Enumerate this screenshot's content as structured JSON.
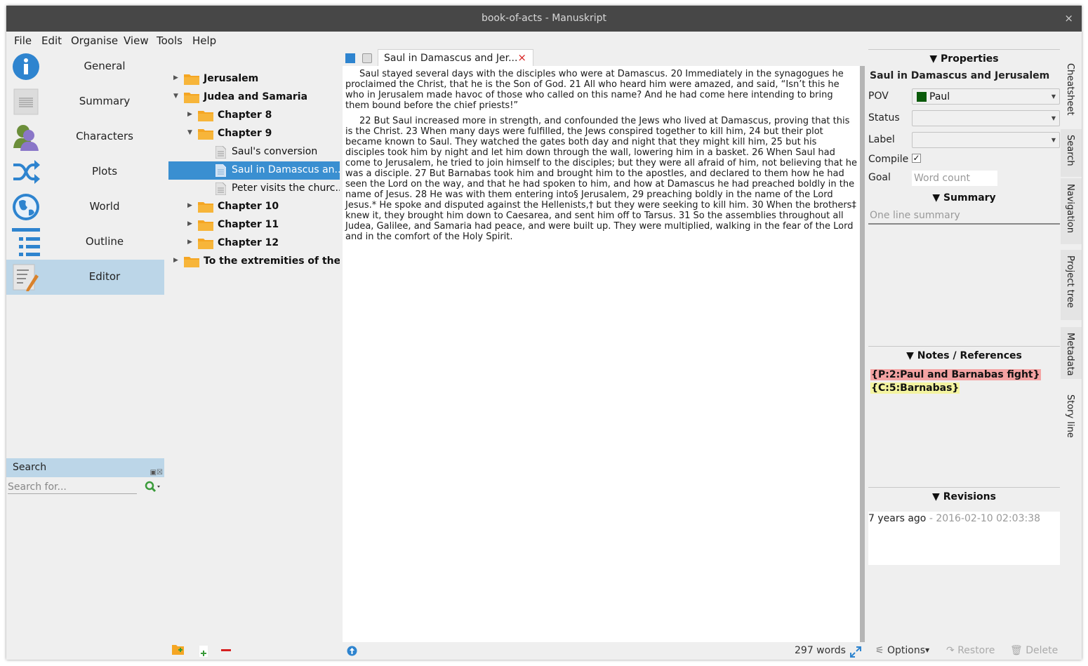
{
  "window": {
    "title": "book-of-acts - Manuskript",
    "close_glyph": "×"
  },
  "menu": {
    "file": "File",
    "edit": "Edit",
    "organise": "Organise",
    "view": "View",
    "tools": "Tools",
    "help": "Help"
  },
  "nav": {
    "general": "General",
    "summary": "Summary",
    "characters": "Characters",
    "plots": "Plots",
    "world": "World",
    "outline": "Outline",
    "editor": "Editor"
  },
  "search": {
    "title": "Search",
    "placeholder": "Search for..."
  },
  "tree": {
    "jerusalem": "Jerusalem",
    "judea": "Judea and Samaria",
    "ch8": "Chapter 8",
    "ch9": "Chapter 9",
    "sauls_conversion": "Saul's conversion",
    "saul_damascus": "Saul in Damascus an...",
    "peter_visits": "Peter visits the churc...",
    "ch10": "Chapter 10",
    "ch11": "Chapter 11",
    "ch12": "Chapter 12",
    "extremities": "To the extremities of the ..."
  },
  "editor": {
    "tab_title": "Saul in Damascus and Jer...",
    "tab_close": "×",
    "paragraph1": "Saul stayed several days with the disciples who were at Damascus. 20 Immediately in the synagogues he proclaimed the Christ, that he is the Son of God. 21 All who heard him were amazed, and said, “Isn’t this he who in Jerusalem made havoc of those who called on this name? And he had come here intending to bring them bound before the chief priests!”",
    "paragraph2": "22 But Saul increased more in strength, and confounded the Jews who lived at Damascus, proving that this is the Christ. 23 When many days were fulfilled, the Jews conspired together to kill him, 24 but their plot became known to Saul. They watched the gates both day and night that they might kill him, 25 but his disciples took him by night and let him down through the wall, lowering him in a basket. 26 When Saul had come to Jerusalem, he tried to join himself to the disciples; but they were all afraid of him, not believing that he was a disciple. 27 But Barnabas took him and brought him to the apostles, and declared to them how he had seen the Lord on the way, and that he had spoken to him, and how at Damascus he had preached boldly in the name of Jesus. 28 He was with them entering into§ Jerusalem, 29 preaching boldly in the name of the Lord Jesus.* He spoke and disputed against the Hellenists,† but they were seeking to kill him. 30 When the brothers‡ knew it, they brought him down to Caesarea, and sent him off to Tarsus. 31 So the assemblies throughout all Judea, Galilee, and Samaria had peace, and were built up. They were multiplied, walking in the fear of the Lord and in the comfort of the Holy Spirit.",
    "word_count": "297 words"
  },
  "properties": {
    "header": "▼ Properties",
    "item_title": "Saul in Damascus and Jerusalem",
    "pov_label": "POV",
    "pov_value": "Paul",
    "pov_color": "#0a5a0a",
    "status_label": "Status",
    "label_label": "Label",
    "compile_label": "Compile",
    "compile_checked": "✓",
    "goal_label": "Goal",
    "goal_placeholder": "Word count",
    "summary_header": "▼ Summary",
    "summary_placeholder": "One line summary",
    "notes_header": "▼ Notes / References",
    "ref1": "{P:2:Paul and Barnabas fight}",
    "ref1_color": "#f4a3a3",
    "ref2": "{C:5:Barnabas}",
    "ref2_color": "#f4f4a0",
    "revisions_header": "▼ Revisions",
    "rev_age": "7 years ago",
    "rev_date": " - 2016-02-10 02:03:38",
    "options": "Options",
    "restore": "Restore",
    "delete": "Delete"
  },
  "side_tabs": {
    "cheatsheet": "Cheatsheet",
    "search": "Search",
    "navigation": "Navigation",
    "project_tree": "Project tree",
    "metadata": "Metadata",
    "story_line": "Story line"
  }
}
